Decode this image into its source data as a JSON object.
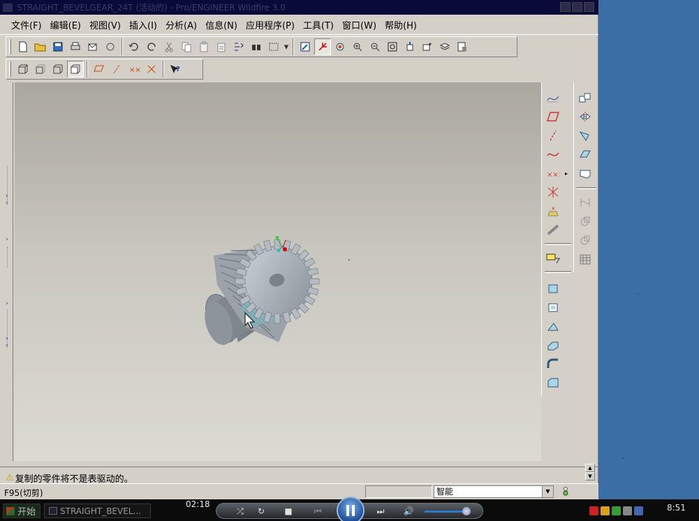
{
  "window": {
    "title": "STRAIGHT_BEVELGEAR_24T (活动的) - Pro/ENGINEER Wildfire 3.0"
  },
  "menu": [
    {
      "label": "文件(F)",
      "name": "menu-file"
    },
    {
      "label": "编辑(E)",
      "name": "menu-edit"
    },
    {
      "label": "视图(V)",
      "name": "menu-view"
    },
    {
      "label": "插入(I)",
      "name": "menu-insert"
    },
    {
      "label": "分析(A)",
      "name": "menu-analysis"
    },
    {
      "label": "信息(N)",
      "name": "menu-info"
    },
    {
      "label": "应用程序(P)",
      "name": "menu-applications"
    },
    {
      "label": "工具(T)",
      "name": "menu-tools"
    },
    {
      "label": "窗口(W)",
      "name": "menu-window"
    },
    {
      "label": "帮助(H)",
      "name": "menu-help"
    }
  ],
  "message": {
    "text": "复制的零件将不是表驱动的。"
  },
  "status": {
    "command": "F95(切剪)",
    "filter": "智能"
  },
  "taskbar": {
    "start_label": "开始",
    "task_label": "STRAIGHT_BEVEL...",
    "clock": "8:51"
  },
  "player": {
    "elapsed": "02:18",
    "volume_level": 0.85
  }
}
